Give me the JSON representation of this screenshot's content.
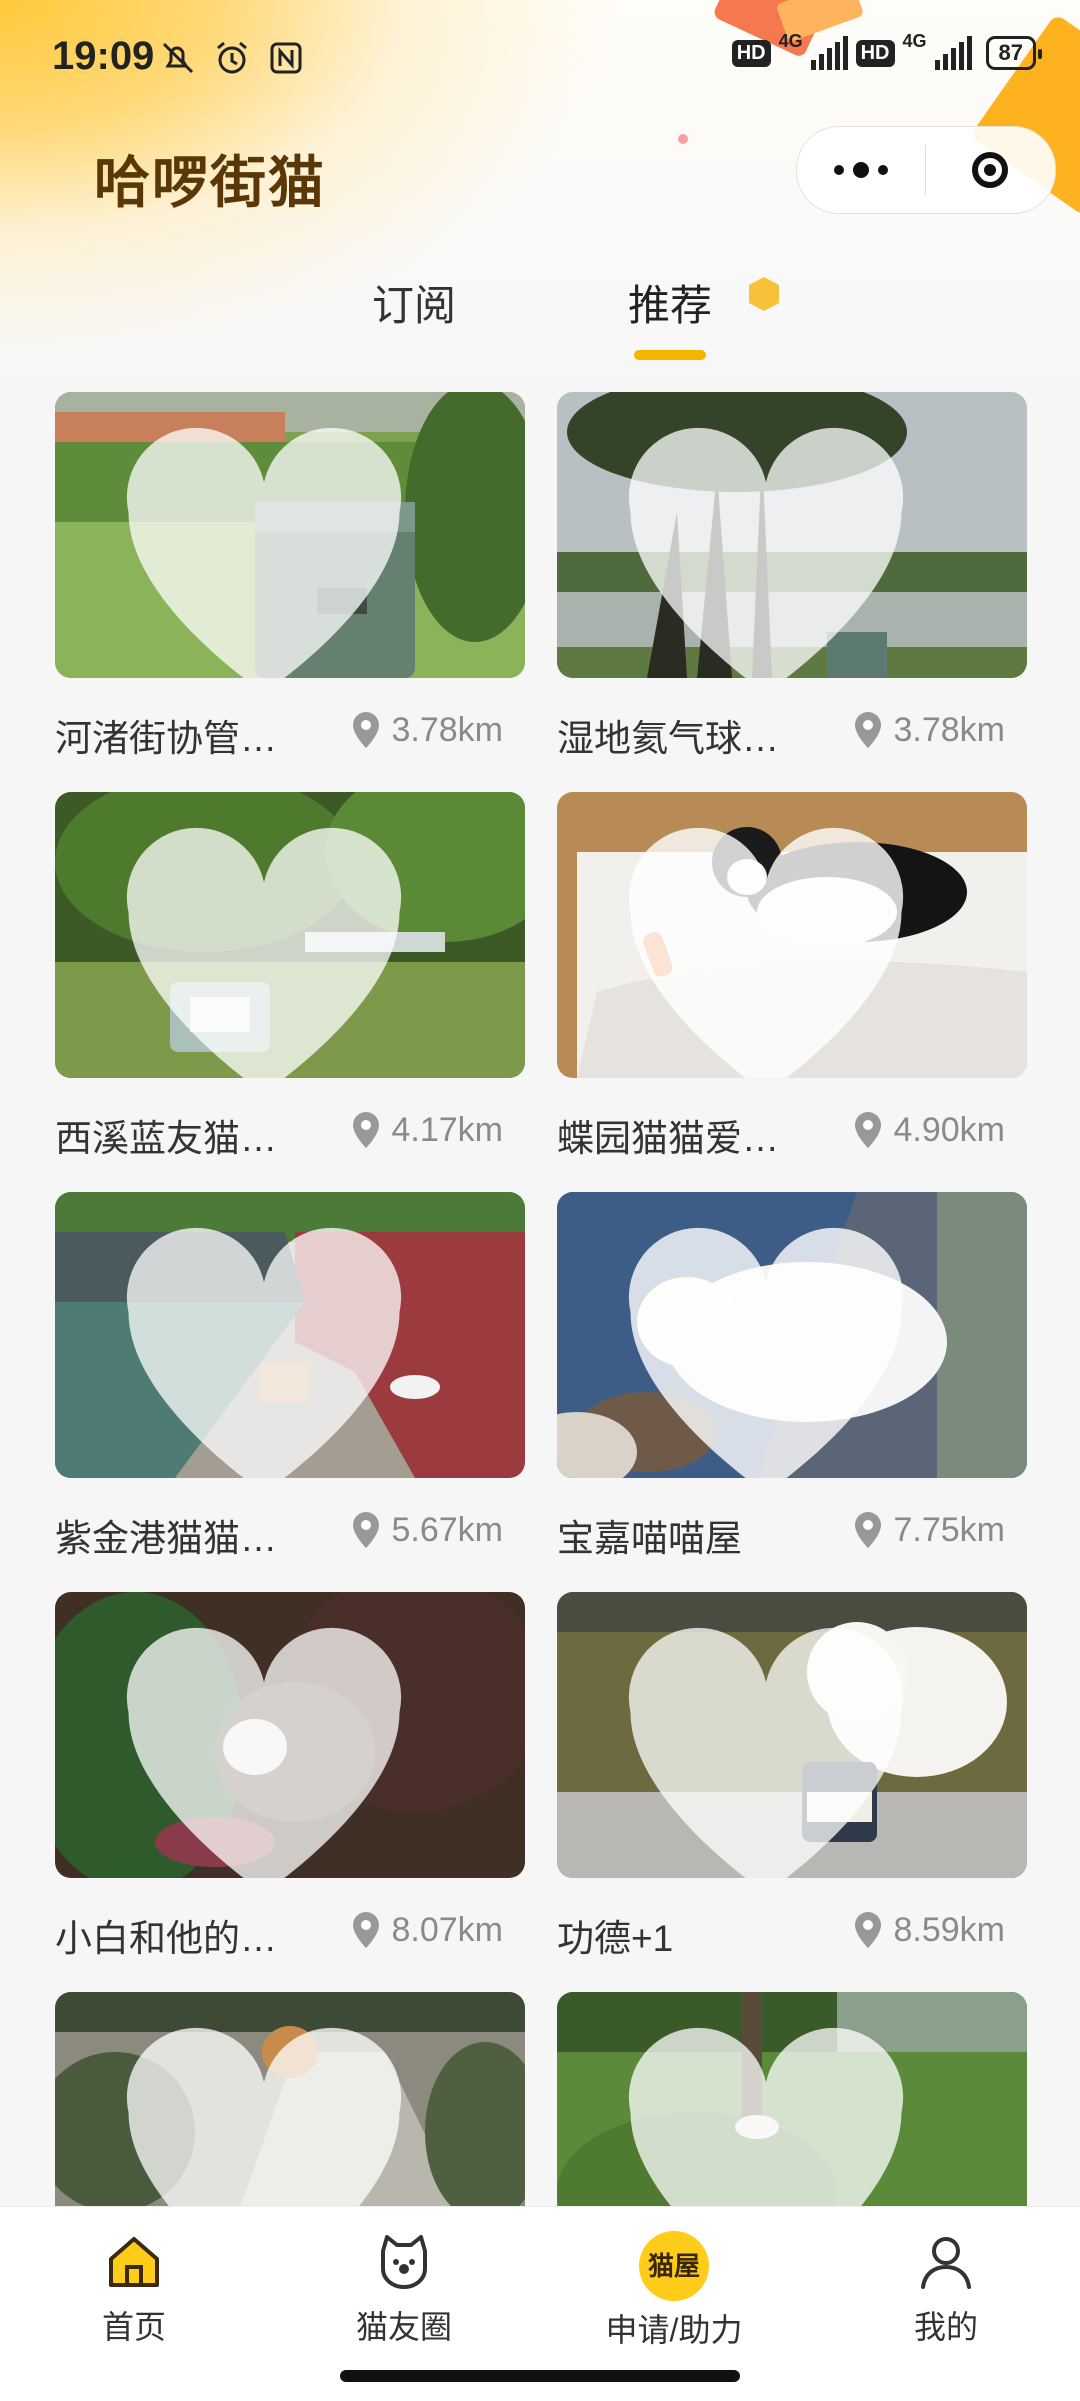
{
  "status": {
    "time": "19:09",
    "battery": "87",
    "net1": "4G",
    "net2": "4G",
    "hd": "HD"
  },
  "app": {
    "title": "哈啰街猫"
  },
  "tabs": {
    "subscribe": "订阅",
    "recommend": "推荐"
  },
  "cards": [
    {
      "name": "河渚街协管…",
      "distance": "3.78km"
    },
    {
      "name": "湿地氦气球…",
      "distance": "3.78km"
    },
    {
      "name": "西溪蓝友猫…",
      "distance": "4.17km"
    },
    {
      "name": "蝶园猫猫爱…",
      "distance": "4.90km"
    },
    {
      "name": "紫金港猫猫…",
      "distance": "5.67km"
    },
    {
      "name": "宝嘉喵喵屋",
      "distance": "7.75km"
    },
    {
      "name": "小白和他的…",
      "distance": "8.07km"
    },
    {
      "name": "功德+1",
      "distance": "8.59km"
    }
  ],
  "tabbar": {
    "home": "首页",
    "circle": "猫友圈",
    "apply": "申请/助力",
    "apply_icon": "猫屋",
    "me": "我的"
  },
  "colors": {
    "accent": "#f4b400",
    "title": "#5a3707"
  }
}
